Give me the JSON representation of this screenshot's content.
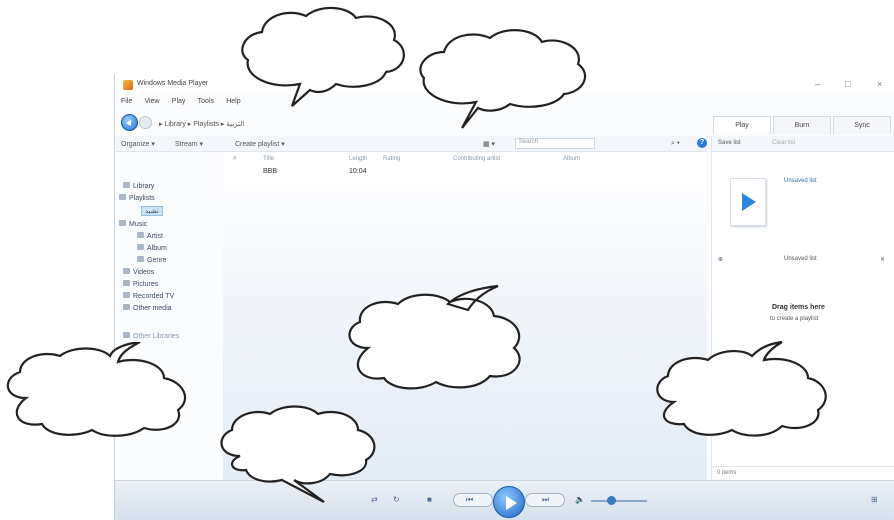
{
  "window": {
    "title": "Windows Media Player",
    "controls": [
      "–",
      "□",
      "×"
    ]
  },
  "menu": [
    "File",
    "View",
    "Play",
    "Tools",
    "Help"
  ],
  "breadcrumb": "▸ Library ▸ Playlists ▸ التربية",
  "tabs": [
    "Play",
    "Burn",
    "Sync"
  ],
  "toolbar": {
    "organize": "Organize ▾",
    "stream": "Stream ▾",
    "create_playlist": "Create playlist ▾",
    "search_placeholder": "Search",
    "help": "?"
  },
  "sidebar": {
    "library": "Library",
    "playlists": "Playlists",
    "playlist_item": "نشيد",
    "music": "Music",
    "artist": "Artist",
    "album": "Album",
    "genre": "Genre",
    "videos": "Videos",
    "pictures": "Pictures",
    "recorded_tv": "Recorded TV",
    "other_media": "Other media",
    "other_libraries": "Other Libraries"
  },
  "columns": [
    "#",
    "Title",
    "Length",
    "Rating",
    "Contributing artist",
    "Album"
  ],
  "rows": [
    {
      "num": "",
      "title": "BBB",
      "length": "10:04",
      "rating": "",
      "artist": "",
      "album": ""
    }
  ],
  "list_pane": {
    "save_list": "Save list",
    "clear_list": "Clear list",
    "unsaved_title": "Unsaved list",
    "header": "Unsaved list",
    "drag_title": "Drag items here",
    "drag_sub": "to create a playlist",
    "items_count": "0 items"
  },
  "player": {
    "shuffle": "⇄",
    "repeat": "↻",
    "stop": "■",
    "prev": "⏮",
    "next": "⏭",
    "mute": "🔈",
    "switch": "⊞"
  },
  "icons": {
    "back": "back-arrow-icon",
    "forward": "forward-arrow-icon",
    "play": "play-icon"
  }
}
